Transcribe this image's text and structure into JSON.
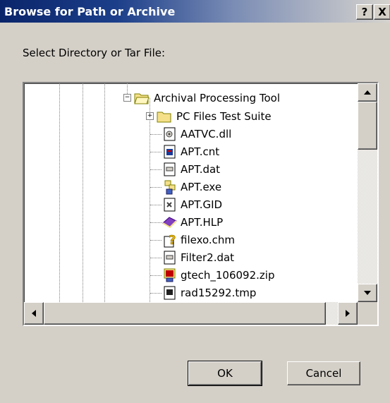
{
  "dialog": {
    "title": "Browse for Path or Archive",
    "help_label": "?",
    "close_label": "X",
    "prompt": "Select Directory or Tar File:",
    "ok_label": "OK",
    "cancel_label": "Cancel"
  },
  "tree": {
    "items": [
      {
        "label": "Archival Processing Tool",
        "icon": "open-folder-icon",
        "expander": "minus"
      },
      {
        "label": "PC Files Test Suite",
        "icon": "folder-icon",
        "expander": "plus"
      },
      {
        "label": "AATVC.dll",
        "icon": "dll-file-icon"
      },
      {
        "label": "APT.cnt",
        "icon": "help-contents-file-icon"
      },
      {
        "label": "APT.dat",
        "icon": "generic-file-icon"
      },
      {
        "label": "APT.exe",
        "icon": "executable-file-icon"
      },
      {
        "label": "APT.GID",
        "icon": "gid-file-icon"
      },
      {
        "label": "APT.HLP",
        "icon": "help-book-icon"
      },
      {
        "label": "filexo.chm",
        "icon": "chm-help-file-icon"
      },
      {
        "label": "Filter2.dat",
        "icon": "generic-file-icon"
      },
      {
        "label": "gtech_106092.zip",
        "icon": "zip-archive-icon"
      },
      {
        "label": "rad15292.tmp",
        "icon": "tmp-file-icon"
      }
    ]
  },
  "colors": {
    "title_bar_start": "#0a246a",
    "dialog_background": "#d4d0c8",
    "folder_yellow": "#f5e08a"
  }
}
